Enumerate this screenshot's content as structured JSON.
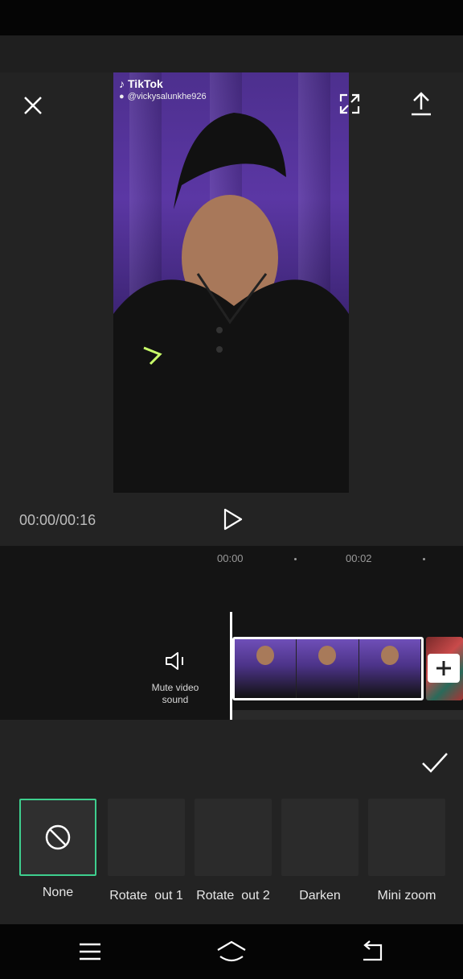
{
  "video": {
    "watermark_brand": "TikTok",
    "watermark_user": "@vickysalunkhe926"
  },
  "playback": {
    "time": "00:00/00:16"
  },
  "ruler": {
    "mark_0": "00:00",
    "mark_1": "00:02"
  },
  "timeline": {
    "mute_label": "Mute video sound"
  },
  "animations": {
    "items": [
      {
        "label": "None",
        "selected": true
      },
      {
        "label": "Rotate  out 1"
      },
      {
        "label": "Rotate  out 2"
      },
      {
        "label": "Darken"
      },
      {
        "label": "Mini zoom"
      }
    ]
  },
  "colors": {
    "accent": "#3ecf8e",
    "background": "#232323"
  },
  "icons": [
    "close-icon",
    "fullscreen-icon",
    "export-icon",
    "play-icon",
    "speaker-icon",
    "plus-icon",
    "check-icon",
    "ban-icon",
    "menu-icon",
    "home-icon",
    "back-icon"
  ]
}
